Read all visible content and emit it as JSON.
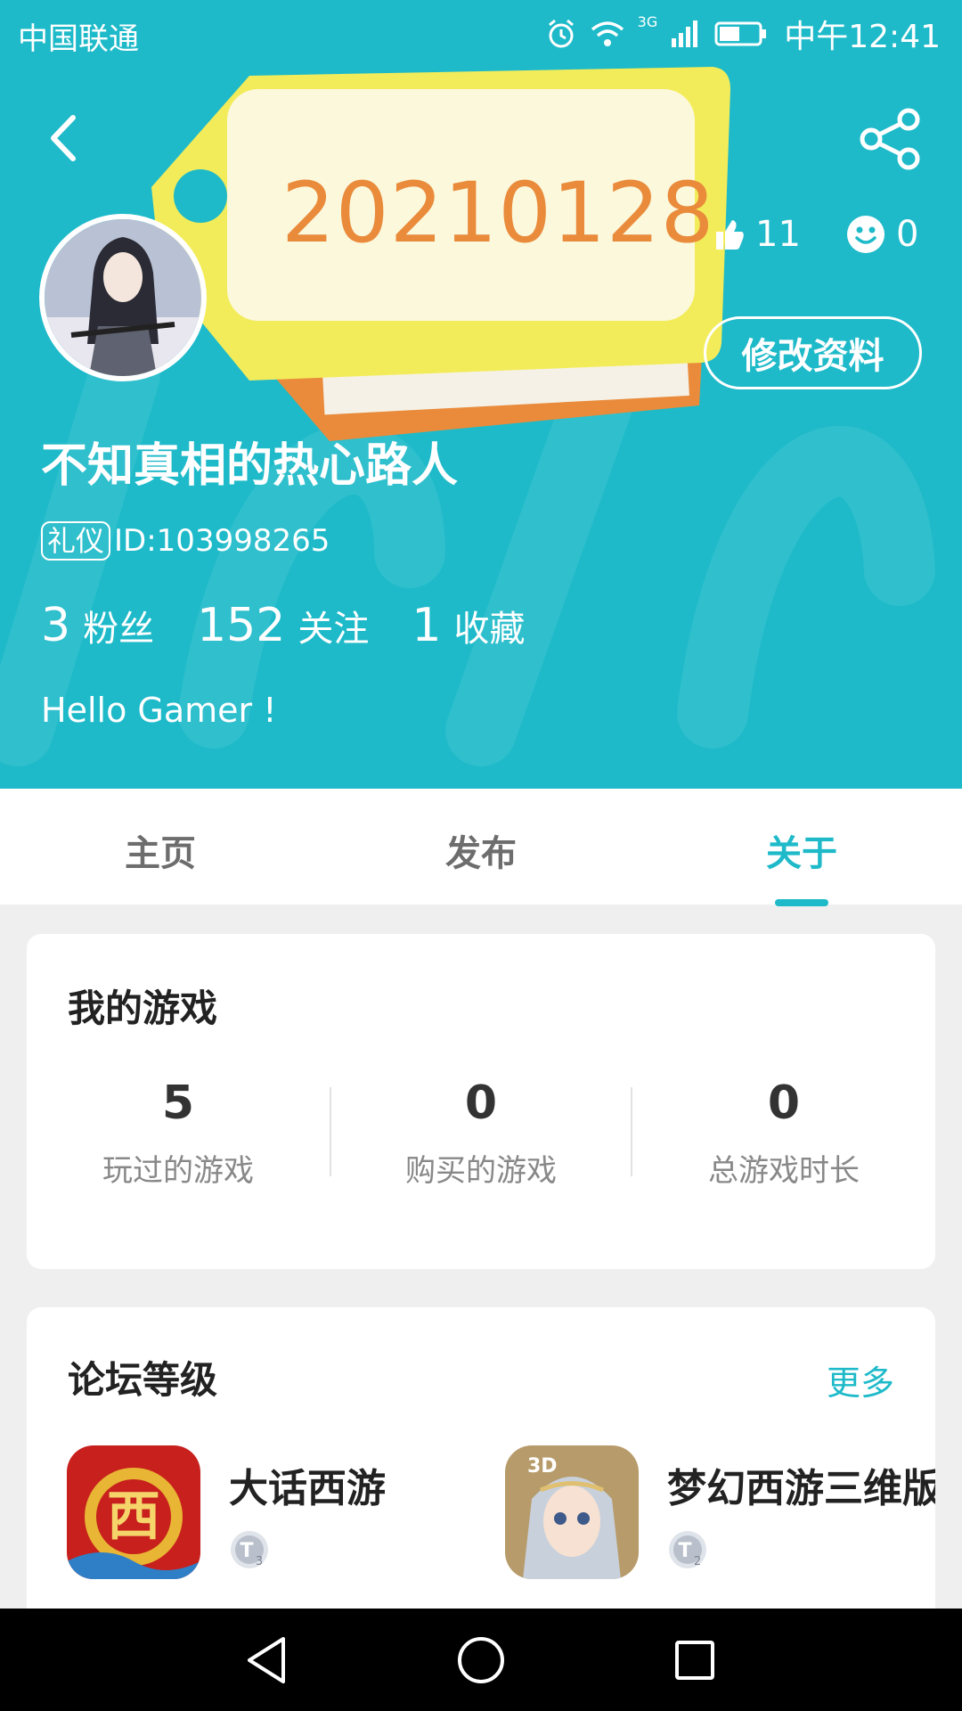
{
  "status_bar": {
    "carrier": "中国联通",
    "network": "3G",
    "time": "中午12:41"
  },
  "tag": {
    "text": "20210128"
  },
  "profile": {
    "likes": "11",
    "smiles": "0",
    "edit_button": "修改资料",
    "username": "不知真相的热心路人",
    "badge": "礼仪",
    "id": "ID:103998265",
    "stats": [
      {
        "num": "3",
        "label": "粉丝"
      },
      {
        "num": "152",
        "label": "关注"
      },
      {
        "num": "1",
        "label": "收藏"
      }
    ],
    "bio": "Hello Gamer !"
  },
  "tabs": [
    {
      "label": "主页"
    },
    {
      "label": "发布"
    },
    {
      "label": "关于"
    }
  ],
  "my_games": {
    "title": "我的游戏",
    "stats": [
      {
        "num": "5",
        "label": "玩过的游戏"
      },
      {
        "num": "0",
        "label": "购买的游戏"
      },
      {
        "num": "0",
        "label": "总游戏时长"
      }
    ]
  },
  "forum_level": {
    "title": "论坛等级",
    "more": "更多",
    "games": [
      {
        "name": "大话西游",
        "level": "3"
      },
      {
        "name": "梦幻西游三维版",
        "level": "2"
      }
    ]
  },
  "colors": {
    "accent": "#1ebac9",
    "tag_yellow": "#f3ec5a",
    "tag_orange": "#e98b3b"
  }
}
